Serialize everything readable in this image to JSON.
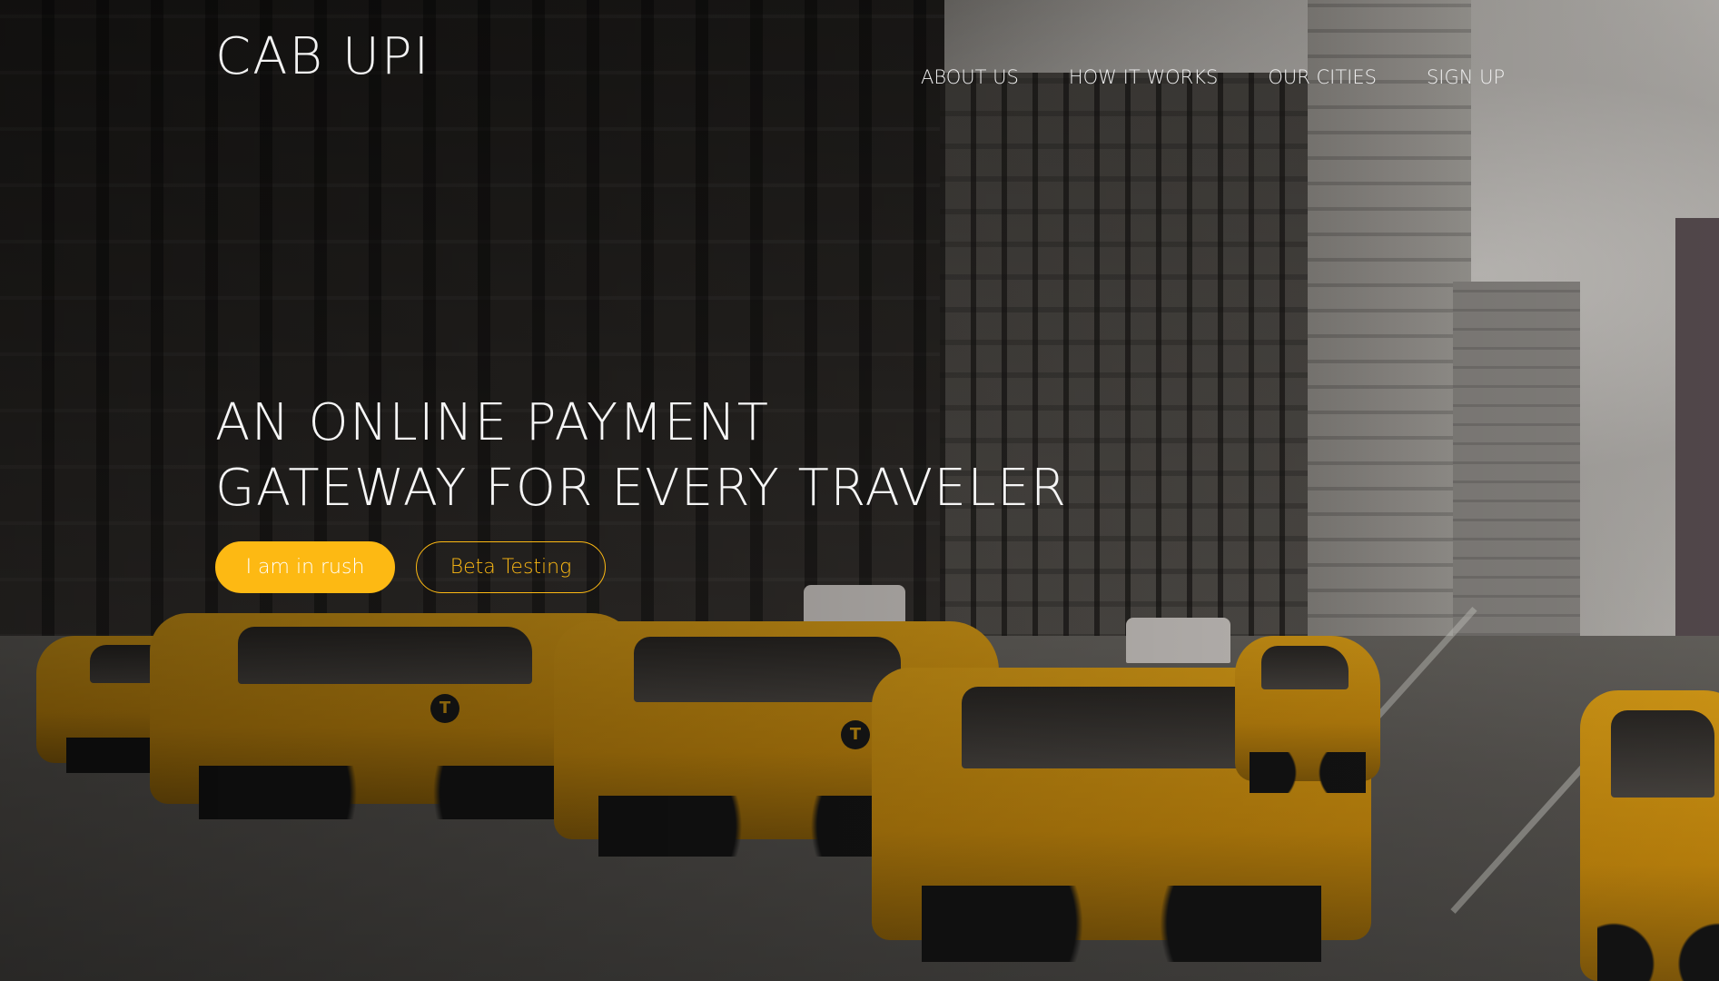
{
  "brand": {
    "name": "CAB UPI"
  },
  "nav": {
    "items": [
      {
        "label": "ABOUT US"
      },
      {
        "label": "HOW IT WORKS"
      },
      {
        "label": "OUR CITIES"
      },
      {
        "label": "SIGN UP"
      }
    ]
  },
  "hero": {
    "headline_line1": "AN ONLINE PAYMENT",
    "headline_line2": "GATEWAY FOR EVERY TRAVELER",
    "primary_button": "I am in rush",
    "secondary_button": "Beta Testing",
    "background_image": "city-street-taxis-photo"
  },
  "colors": {
    "accent": "#fdb913",
    "text": "#ffffff",
    "overlay": "rgba(0,0,0,0.45)"
  }
}
